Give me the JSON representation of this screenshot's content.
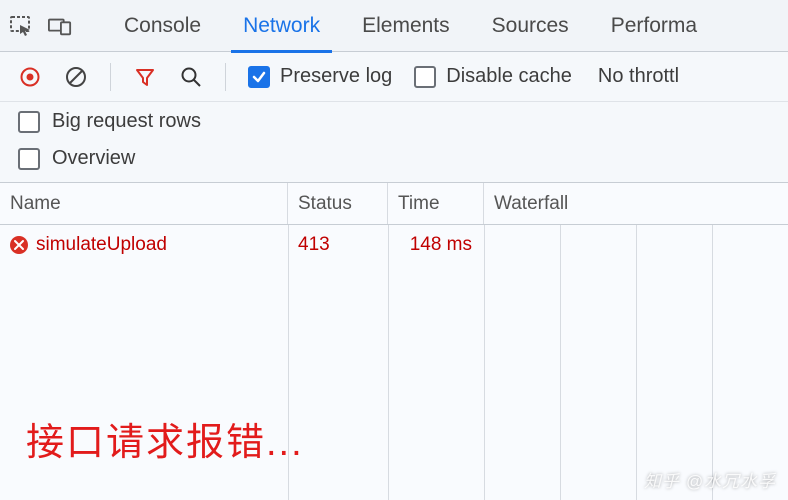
{
  "tabs": {
    "items": [
      "Console",
      "Network",
      "Elements",
      "Sources",
      "Performa"
    ],
    "activeIndex": 1
  },
  "toolbar": {
    "preserve_log_label": "Preserve log",
    "preserve_log_checked": true,
    "disable_cache_label": "Disable cache",
    "disable_cache_checked": false,
    "throttling_label": "No throttl"
  },
  "options": {
    "big_rows_label": "Big request rows",
    "big_rows_checked": false,
    "overview_label": "Overview",
    "overview_checked": false
  },
  "grid": {
    "columns": [
      "Name",
      "Status",
      "Time",
      "Waterfall"
    ],
    "rows": [
      {
        "error": true,
        "name": "simulateUpload",
        "status": "413",
        "time": "148 ms"
      }
    ]
  },
  "annotation": "接口请求报错...",
  "watermark": "知乎 @水冗水孚"
}
